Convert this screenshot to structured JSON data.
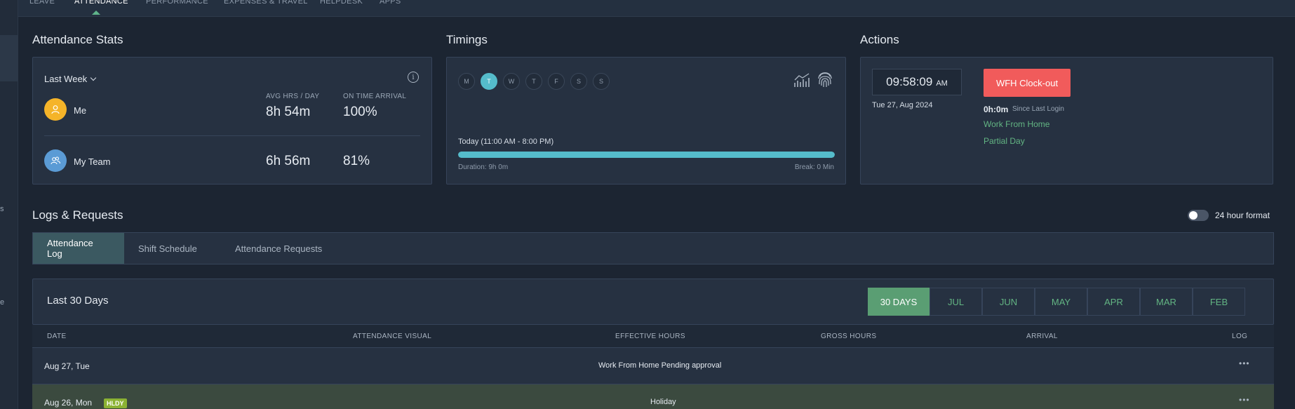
{
  "nav": {
    "tabs": [
      {
        "label": "LEAVE"
      },
      {
        "label": "ATTENDANCE"
      },
      {
        "label": "PERFORMANCE"
      },
      {
        "label": "EXPENSES & TRAVEL"
      },
      {
        "label": "HELPDESK"
      },
      {
        "label": "APPS"
      }
    ],
    "active_tab": "ATTENDANCE"
  },
  "rail_fragments": [
    "s",
    "e"
  ],
  "stats": {
    "title": "Attendance Stats",
    "period": "Last Week",
    "info_icon": "info-icon",
    "col_avg": "AVG HRS / DAY",
    "col_ontime": "ON TIME ARRIVAL",
    "rows": [
      {
        "name": "Me",
        "avg": "8h 54m",
        "ontime": "100%",
        "icon": "user-icon",
        "color": "#f5b429"
      },
      {
        "name": "My Team",
        "avg": "6h 56m",
        "ontime": "81%",
        "icon": "team-icon",
        "color": "#5b9bd5"
      }
    ]
  },
  "timings": {
    "title": "Timings",
    "days": [
      "M",
      "T",
      "W",
      "T",
      "F",
      "S",
      "S"
    ],
    "active_day_index": 1,
    "today_label": "Today (11:00 AM - 8:00 PM)",
    "progress": 1.0,
    "duration": "Duration: 9h 0m",
    "break": "Break: 0 Min"
  },
  "actions": {
    "title": "Actions",
    "time": "09:58:09",
    "ampm": "AM",
    "date": "Tue 27, Aug 2024",
    "clockout_label": "WFH Clock-out",
    "since_value": "0h:0m",
    "since_label": "Since Last Login",
    "link_wfh": "Work From Home",
    "link_partial": "Partial Day"
  },
  "logs": {
    "title": "Logs & Requests",
    "toggle_label": "24 hour format",
    "toggle_on": false,
    "subtabs": [
      "Attendance Log",
      "Shift Schedule",
      "Attendance Requests"
    ],
    "active_subtab": 0,
    "period_title": "Last 30 Days",
    "months": [
      "30 DAYS",
      "JUL",
      "JUN",
      "MAY",
      "APR",
      "MAR",
      "FEB"
    ],
    "active_month": 0,
    "columns": [
      "DATE",
      "ATTENDANCE VISUAL",
      "EFFECTIVE HOURS",
      "GROSS HOURS",
      "ARRIVAL",
      "LOG"
    ],
    "rows": [
      {
        "date": "Aug 27, Tue",
        "badge": "",
        "note": "Work From Home Pending approval",
        "log": "•••"
      },
      {
        "date": "Aug 26, Mon",
        "badge": "HLDY",
        "note": "Holiday",
        "log": "•••"
      }
    ]
  },
  "colors": {
    "accent_green": "#63b583",
    "accent_cyan": "#55bccb",
    "danger": "#f15b5b",
    "holiday_badge": "#8bb234"
  }
}
